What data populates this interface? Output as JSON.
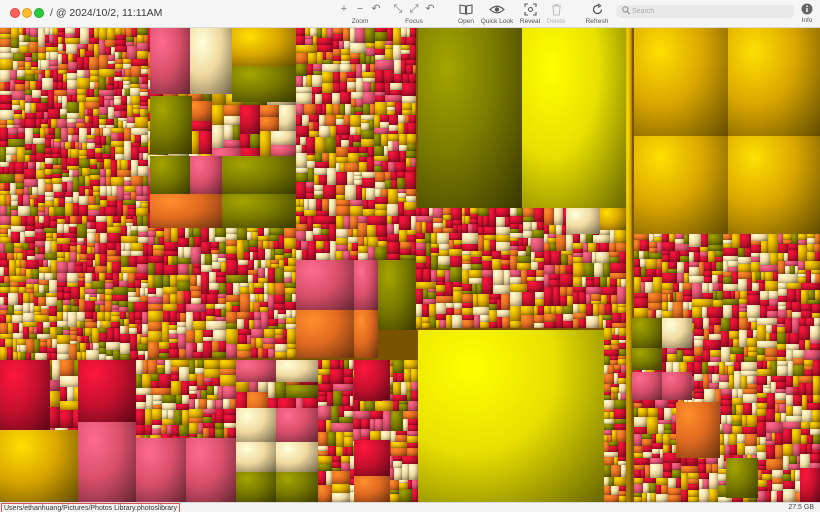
{
  "window": {
    "title": "/ @ 2024/10/2, 11:11AM"
  },
  "toolbar": {
    "zoom_label": "Zoom",
    "focus_label": "Focus",
    "open_label": "Open",
    "quicklook_label": "Quick Look",
    "reveal_label": "Reveal",
    "delete_label": "Delete",
    "refresh_label": "Refresh",
    "info_label": "Info"
  },
  "search": {
    "placeholder": "Search",
    "value": ""
  },
  "status": {
    "path": "Users/ethanhuang/Pictures/Photos Library.photoslibrary",
    "size": "27.5 GB"
  },
  "colors": {
    "red": "#c8102e",
    "pink": "#d94f6b",
    "olive": "#7a7a00",
    "yellow": "#e8e000",
    "gold": "#d9a600",
    "cream": "#f0d9a0",
    "orange": "#e06a20"
  }
}
